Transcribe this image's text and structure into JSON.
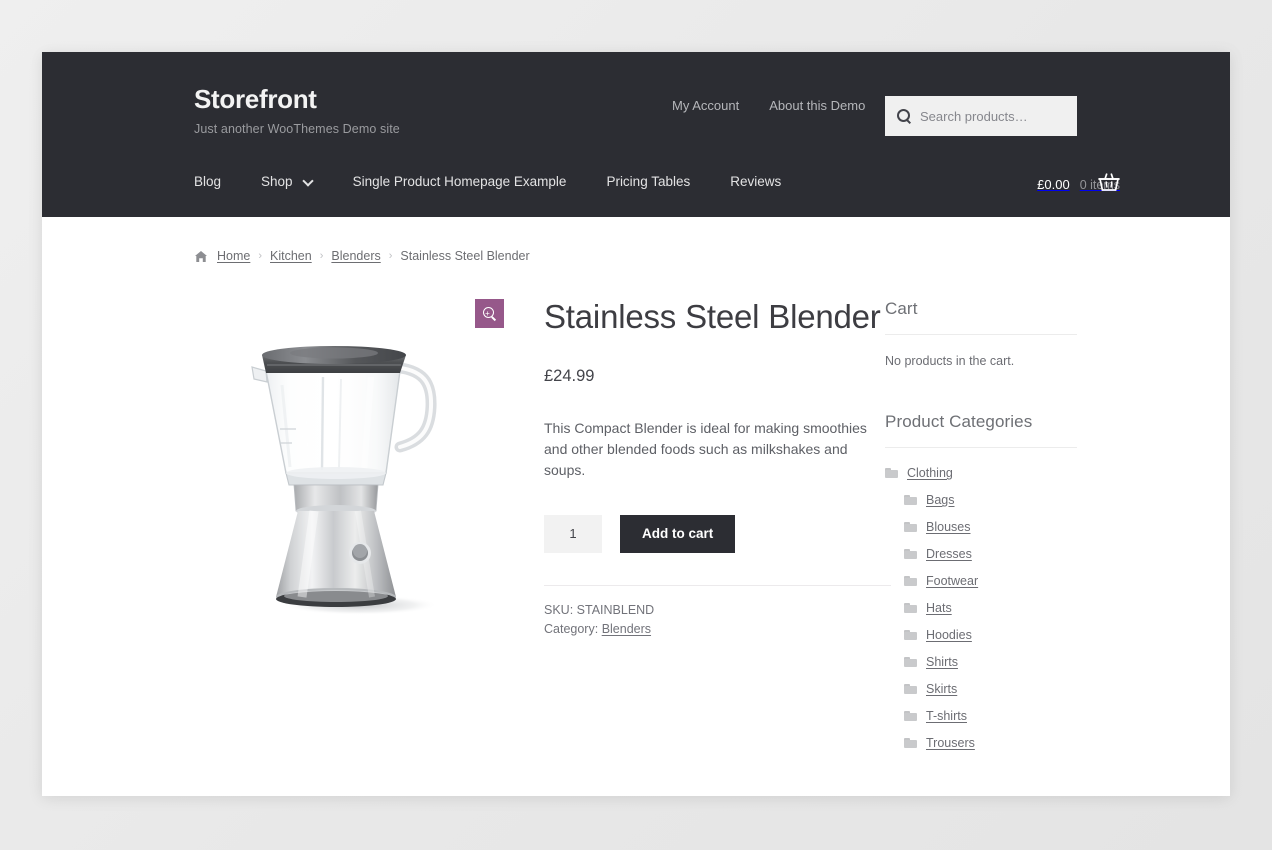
{
  "header": {
    "site_title": "Storefront",
    "site_description": "Just another WooThemes Demo site",
    "secondary_nav": [
      {
        "label": "My Account"
      },
      {
        "label": "About this Demo"
      }
    ],
    "search": {
      "placeholder": "Search products…",
      "value": "",
      "icon": "search-icon"
    },
    "main_nav": [
      {
        "label": "Blog",
        "has_dropdown": false
      },
      {
        "label": "Shop",
        "has_dropdown": true
      },
      {
        "label": "Single Product Homepage Example",
        "has_dropdown": false
      },
      {
        "label": "Pricing Tables",
        "has_dropdown": false
      },
      {
        "label": "Reviews",
        "has_dropdown": false
      }
    ],
    "cart": {
      "amount": "£0.00",
      "count": "0 items",
      "icon": "shopping-basket-icon"
    }
  },
  "breadcrumb": {
    "home_icon": "home-icon",
    "items": [
      {
        "label": "Home",
        "is_link": true
      },
      {
        "label": "Kitchen",
        "is_link": true
      },
      {
        "label": "Blenders",
        "is_link": true
      },
      {
        "label": "Stainless Steel Blender",
        "is_link": false
      }
    ],
    "separator": "›"
  },
  "product": {
    "title": "Stainless Steel Blender",
    "price": "£24.99",
    "description": "This Compact Blender is ideal for making smoothies and other blended foods such as milkshakes and soups.",
    "quantity": "1",
    "add_to_cart_label": "Add to cart",
    "sku_line": "SKU: STAINBLEND",
    "category_label": "Category:",
    "category_value": "Blenders",
    "zoom_icon": "magnifier-plus-icon",
    "image_alt": "Stainless Steel Blender"
  },
  "sidebar": {
    "cart_widget": {
      "title": "Cart",
      "empty_message": "No products in the cart."
    },
    "categories_widget": {
      "title": "Product Categories",
      "items": [
        {
          "label": "Clothing",
          "level": 0
        },
        {
          "label": "Bags",
          "level": 1
        },
        {
          "label": "Blouses",
          "level": 1
        },
        {
          "label": "Dresses",
          "level": 1
        },
        {
          "label": "Footwear",
          "level": 1
        },
        {
          "label": "Hats",
          "level": 1
        },
        {
          "label": "Hoodies",
          "level": 1
        },
        {
          "label": "Shirts",
          "level": 1
        },
        {
          "label": "Skirts",
          "level": 1
        },
        {
          "label": "T-shirts",
          "level": 1
        },
        {
          "label": "Trousers",
          "level": 1
        }
      ]
    }
  },
  "colors": {
    "header_bg": "#2c2d33",
    "page_bg": "#eaeaea",
    "accent_purple": "#96588a",
    "button_dark": "#2c2d33"
  }
}
